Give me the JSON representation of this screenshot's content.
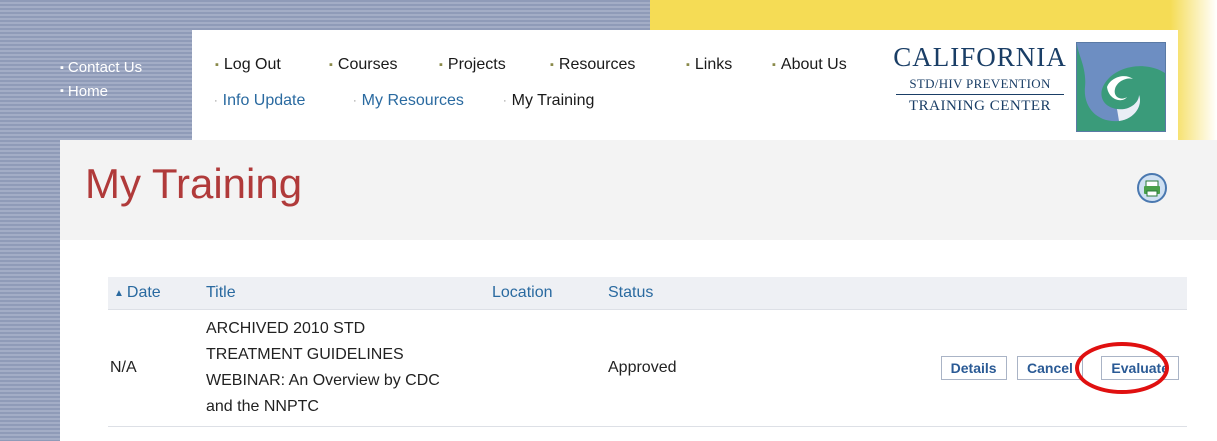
{
  "side_nav": {
    "items": [
      {
        "label": "Contact Us"
      },
      {
        "label": "Home"
      }
    ]
  },
  "primary_nav": {
    "items": [
      {
        "label": "Log Out"
      },
      {
        "label": "Courses"
      },
      {
        "label": "Projects"
      },
      {
        "label": "Resources"
      },
      {
        "label": "Links"
      },
      {
        "label": "About Us"
      }
    ]
  },
  "secondary_nav": {
    "items": [
      {
        "label": "Info Update"
      },
      {
        "label": "My Resources"
      },
      {
        "label": "My Training"
      }
    ],
    "current": "My Training"
  },
  "logo": {
    "line1": "CALIFORNIA",
    "line2": "STD/HIV PREVENTION",
    "line3": "TRAINING CENTER"
  },
  "page": {
    "title": "My Training"
  },
  "table": {
    "columns": [
      "Date",
      "Title",
      "Location",
      "Status"
    ],
    "sort_column": "Date",
    "rows": [
      {
        "date": "N/A",
        "title_lines": [
          "ARCHIVED 2010 STD",
          "TREATMENT GUIDELINES",
          "WEBINAR: An Overview by CDC",
          "and the NNPTC"
        ],
        "location": "",
        "status": "Approved",
        "actions": {
          "details": "Details",
          "cancel": "Cancel",
          "evaluate": "Evaluate"
        }
      }
    ]
  },
  "icons": {
    "print": "printer-icon",
    "sort": "sort-up-icon"
  },
  "colors": {
    "title_red": "#b03a3a",
    "link_blue": "#2a6aa0",
    "banner_yellow": "#f5dc55",
    "highlight_red": "#e01010",
    "logo_teal": "#3a9b7a"
  }
}
